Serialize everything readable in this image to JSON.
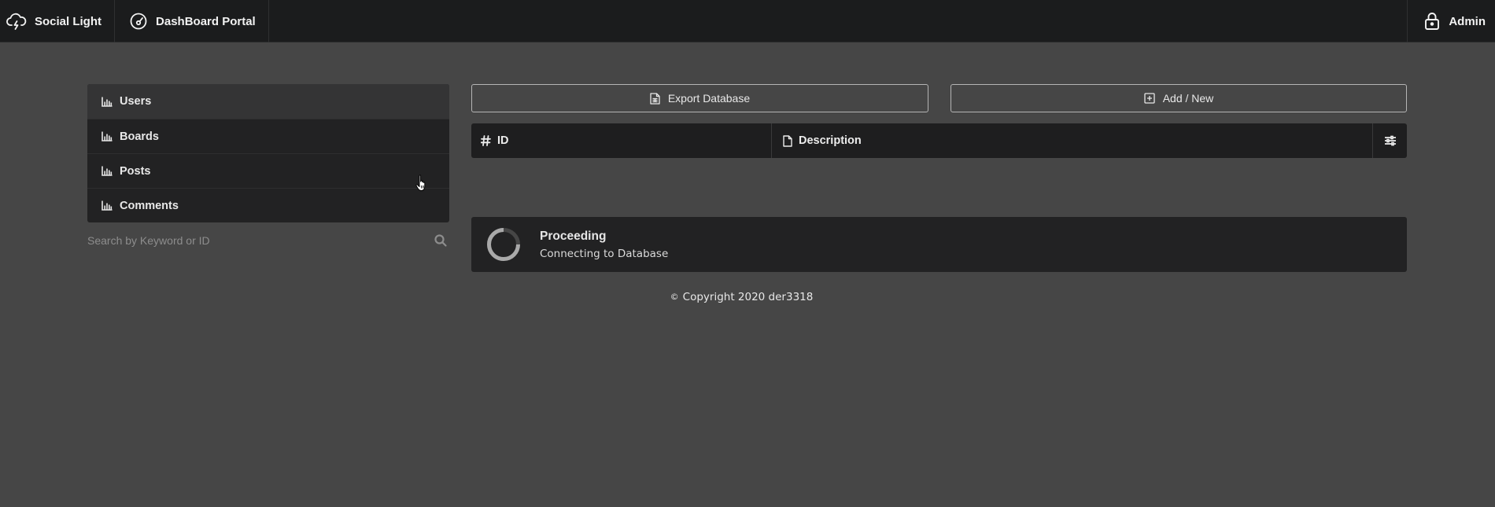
{
  "topbar": {
    "brand_label": "Social Light",
    "brand_icon": "cloud-lightning-icon",
    "portal_label": "DashBoard Portal",
    "portal_icon": "speedometer-icon",
    "admin_label": "Admin",
    "admin_icon": "lock-icon"
  },
  "sidebar": {
    "items": [
      {
        "label": "Users",
        "icon": "bar-chart-icon",
        "active": true
      },
      {
        "label": "Boards",
        "icon": "bar-chart-icon",
        "active": false
      },
      {
        "label": "Posts",
        "icon": "bar-chart-icon",
        "active": false
      },
      {
        "label": "Comments",
        "icon": "bar-chart-icon",
        "active": false
      }
    ],
    "search": {
      "placeholder": "Search by Keyword or ID",
      "value": "",
      "icon": "search-icon"
    }
  },
  "toolbar": {
    "export_label": "Export Database",
    "export_icon": "file-spreadsheet-icon",
    "add_label": "Add / New",
    "add_icon": "plus-square-icon"
  },
  "table": {
    "columns": [
      {
        "label": "ID",
        "icon": "hash-icon"
      },
      {
        "label": "Description",
        "icon": "file-icon"
      }
    ],
    "options_icon": "sliders-icon"
  },
  "loader": {
    "title": "Proceeding",
    "subtitle": "Connecting to Database"
  },
  "footer": {
    "copyright_symbol": "©",
    "text": "Copyright 2020 der3318"
  },
  "colors": {
    "page_bg": "#464646",
    "topbar_bg": "#1b1c1d",
    "panel_bg": "#222223",
    "active_item_bg": "#343435",
    "text": "#e6e6e6"
  }
}
